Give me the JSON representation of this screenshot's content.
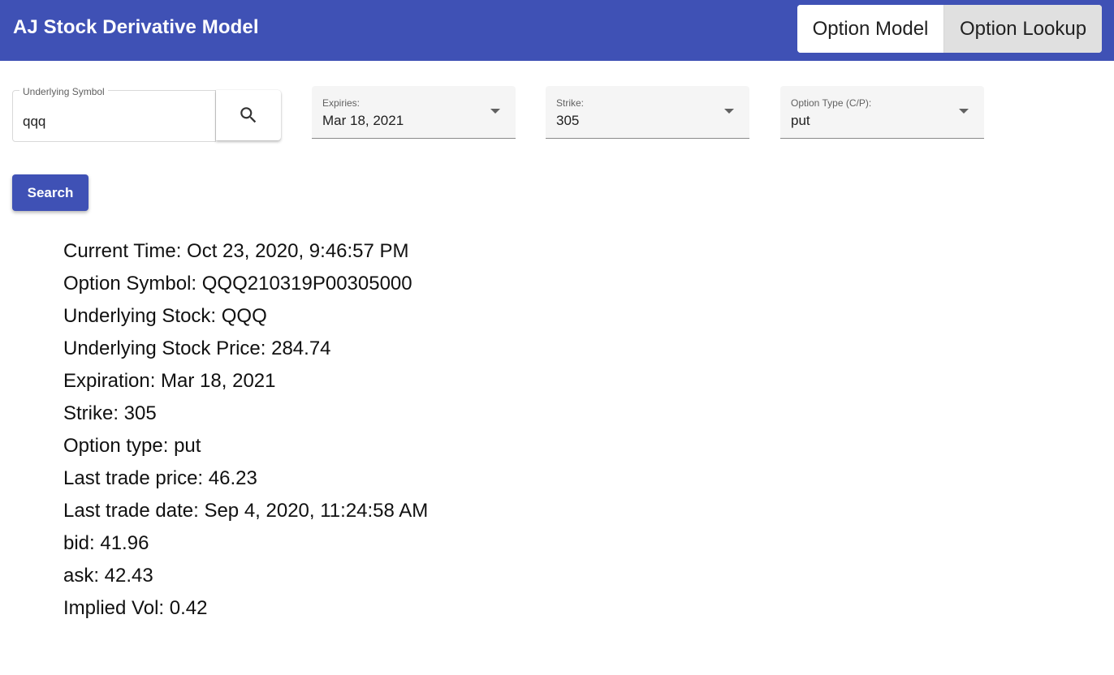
{
  "header": {
    "title": "AJ Stock Derivative Model",
    "nav": {
      "option_model": "Option Model",
      "option_lookup": "Option Lookup"
    }
  },
  "form": {
    "symbol": {
      "label": "Underlying Symbol",
      "value": "qqq"
    },
    "search_icon": "search-icon",
    "expiries": {
      "label": "Expiries:",
      "value": "Mar 18, 2021"
    },
    "strike": {
      "label": "Strike:",
      "value": "305"
    },
    "option_type": {
      "label": "Option Type (C/P):",
      "value": "put"
    },
    "search_button": "Search"
  },
  "results": [
    "Current Time: Oct 23, 2020, 9:46:57 PM",
    "Option Symbol: QQQ210319P00305000",
    "Underlying Stock: QQQ",
    "Underlying Stock Price: 284.74",
    "Expiration: Mar 18, 2021",
    "Strike: 305",
    "Option type: put",
    "Last trade price: 46.23",
    "Last trade date: Sep 4, 2020, 11:24:58 AM",
    "bid: 41.96",
    "ask: 42.43",
    "Implied Vol: 0.42"
  ],
  "colors": {
    "primary": "#3f51b5",
    "selected_nav": "#e0e0e0"
  }
}
